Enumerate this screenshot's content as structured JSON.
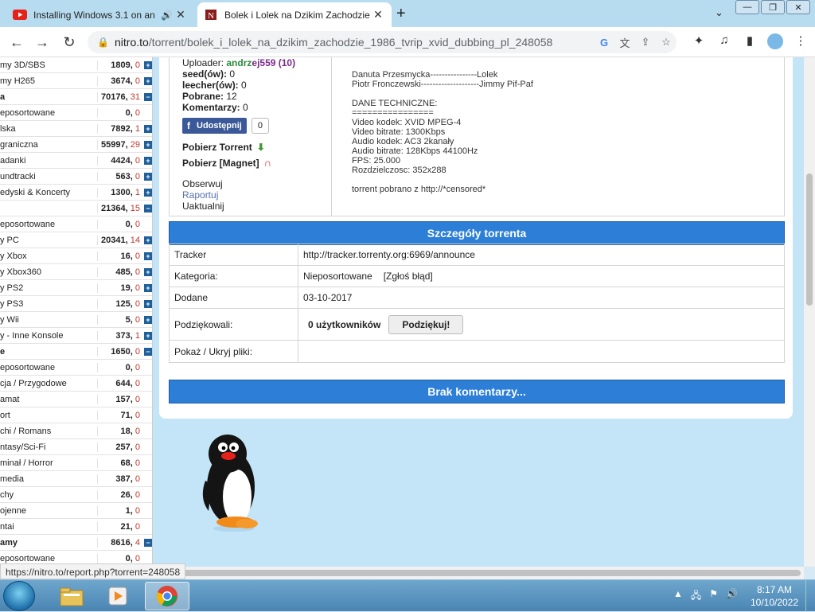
{
  "browser": {
    "tabs": [
      {
        "title": "Installing Windows 3.1 on an",
        "favicon": "youtube-icon",
        "audio": true,
        "active": false
      },
      {
        "title": "Bolek i Lolek na Dzikim Zachodzie",
        "favicon": "site-icon",
        "audio": false,
        "active": true
      }
    ],
    "url_host": "nitro.to",
    "url_path": "/torrent/bolek_i_lolek_na_dzikim_zachodzie_1986_tvrip_xvid_dubbing_pl_248058"
  },
  "sidebar": [
    {
      "name": "my 3D/SBS",
      "count": "1809,",
      "new": "0",
      "toggle": "+",
      "bold": false
    },
    {
      "name": "my H265",
      "count": "3674,",
      "new": "0",
      "toggle": "+",
      "bold": false
    },
    {
      "name": "a",
      "count": "70176,",
      "new": "31",
      "toggle": "−",
      "bold": true
    },
    {
      "name": "eposortowane",
      "count": "0,",
      "new": "0",
      "toggle": "",
      "bold": false
    },
    {
      "name": "lska",
      "count": "7892,",
      "new": "1",
      "toggle": "+",
      "bold": false
    },
    {
      "name": "graniczna",
      "count": "55997,",
      "new": "29",
      "toggle": "+",
      "bold": false
    },
    {
      "name": "adanki",
      "count": "4424,",
      "new": "0",
      "toggle": "+",
      "bold": false
    },
    {
      "name": "undtracki",
      "count": "563,",
      "new": "0",
      "toggle": "+",
      "bold": false
    },
    {
      "name": "edyski & Koncerty",
      "count": "1300,",
      "new": "1",
      "toggle": "+",
      "bold": false
    },
    {
      "name": "",
      "count": "21364,",
      "new": "15",
      "toggle": "−",
      "bold": true
    },
    {
      "name": "eposortowane",
      "count": "0,",
      "new": "0",
      "toggle": "",
      "bold": false
    },
    {
      "name": "y PC",
      "count": "20341,",
      "new": "14",
      "toggle": "+",
      "bold": false
    },
    {
      "name": "y Xbox",
      "count": "16,",
      "new": "0",
      "toggle": "+",
      "bold": false
    },
    {
      "name": "y Xbox360",
      "count": "485,",
      "new": "0",
      "toggle": "+",
      "bold": false
    },
    {
      "name": "y PS2",
      "count": "19,",
      "new": "0",
      "toggle": "+",
      "bold": false
    },
    {
      "name": "y PS3",
      "count": "125,",
      "new": "0",
      "toggle": "+",
      "bold": false
    },
    {
      "name": "y Wii",
      "count": "5,",
      "new": "0",
      "toggle": "+",
      "bold": false
    },
    {
      "name": "y - Inne Konsole",
      "count": "373,",
      "new": "1",
      "toggle": "+",
      "bold": false
    },
    {
      "name": "e",
      "count": "1650,",
      "new": "0",
      "toggle": "−",
      "bold": true
    },
    {
      "name": "eposortowane",
      "count": "0,",
      "new": "0",
      "toggle": "",
      "bold": false
    },
    {
      "name": "cja / Przygodowe",
      "count": "644,",
      "new": "0",
      "toggle": "",
      "bold": false
    },
    {
      "name": "amat",
      "count": "157,",
      "new": "0",
      "toggle": "",
      "bold": false
    },
    {
      "name": "ort",
      "count": "71,",
      "new": "0",
      "toggle": "",
      "bold": false
    },
    {
      "name": "chi / Romans",
      "count": "18,",
      "new": "0",
      "toggle": "",
      "bold": false
    },
    {
      "name": "ntasy/Sci-Fi",
      "count": "257,",
      "new": "0",
      "toggle": "",
      "bold": false
    },
    {
      "name": "minał / Horror",
      "count": "68,",
      "new": "0",
      "toggle": "",
      "bold": false
    },
    {
      "name": "media",
      "count": "387,",
      "new": "0",
      "toggle": "",
      "bold": false
    },
    {
      "name": "chy",
      "count": "26,",
      "new": "0",
      "toggle": "",
      "bold": false
    },
    {
      "name": "ojenne",
      "count": "1,",
      "new": "0",
      "toggle": "",
      "bold": false
    },
    {
      "name": "ntai",
      "count": "21,",
      "new": "0",
      "toggle": "",
      "bold": false
    },
    {
      "name": "amy",
      "count": "8616,",
      "new": "4",
      "toggle": "−",
      "bold": true
    },
    {
      "name": "eposortowane",
      "count": "0,",
      "new": "0",
      "toggle": "",
      "bold": false
    }
  ],
  "info": {
    "uploader_label": "Uploader:",
    "uploader_name_green": "andrz",
    "uploader_name_rest": "ej559 (10)",
    "seeds_label": "seed(ów):",
    "seeds": "0",
    "leechers_label": "leecher(ów):",
    "leechers": "0",
    "downloads_label": "Pobrane:",
    "downloads": "12",
    "comments_label": "Komentarzy:",
    "comments": "0",
    "share_label": "Udostępnij",
    "share_count": "0",
    "download_torrent": "Pobierz Torrent",
    "download_magnet": "Pobierz [Magnet]",
    "watch": "Obserwuj",
    "report": "Raportuj",
    "update": "Uaktualnij"
  },
  "description": "Danuta Przesmycka----------------Lolek\nPiotr Fronczewski--------------------Jimmy Pif-Paf\n\nDANE TECHNICZNE:\n================\nVideo kodek: XVID MPEG-4\nVideo bitrate: 1300Kbps\nAudio kodek: AC3 2kanały\nAudio bitrate: 128Kbps 44100Hz\nFPS: 25.000\nRozdzielczosc: 352x288\n\ntorrent pobrano z http://*censored*",
  "details": {
    "header": "Szczegóły torrenta",
    "rows": [
      {
        "key": "Tracker",
        "value": "http://tracker.torrenty.org:6969/announce"
      },
      {
        "key": "Kategoria:",
        "value": "Nieposortowane",
        "extra": "[Zgłoś błąd]"
      },
      {
        "key": "Dodane",
        "value": "03-10-2017"
      },
      {
        "key": "Podziękowali:",
        "value": "0 użytkowników",
        "button": "Podziękuj!"
      },
      {
        "key": "Pokaż / Ukryj pliki:",
        "value": ""
      }
    ]
  },
  "comments_header": "Brak komentarzy...",
  "status_url": "https://nitro.to/report.php?torrent=248058",
  "taskbar": {
    "time": "8:17 AM",
    "date": "10/10/2022"
  }
}
